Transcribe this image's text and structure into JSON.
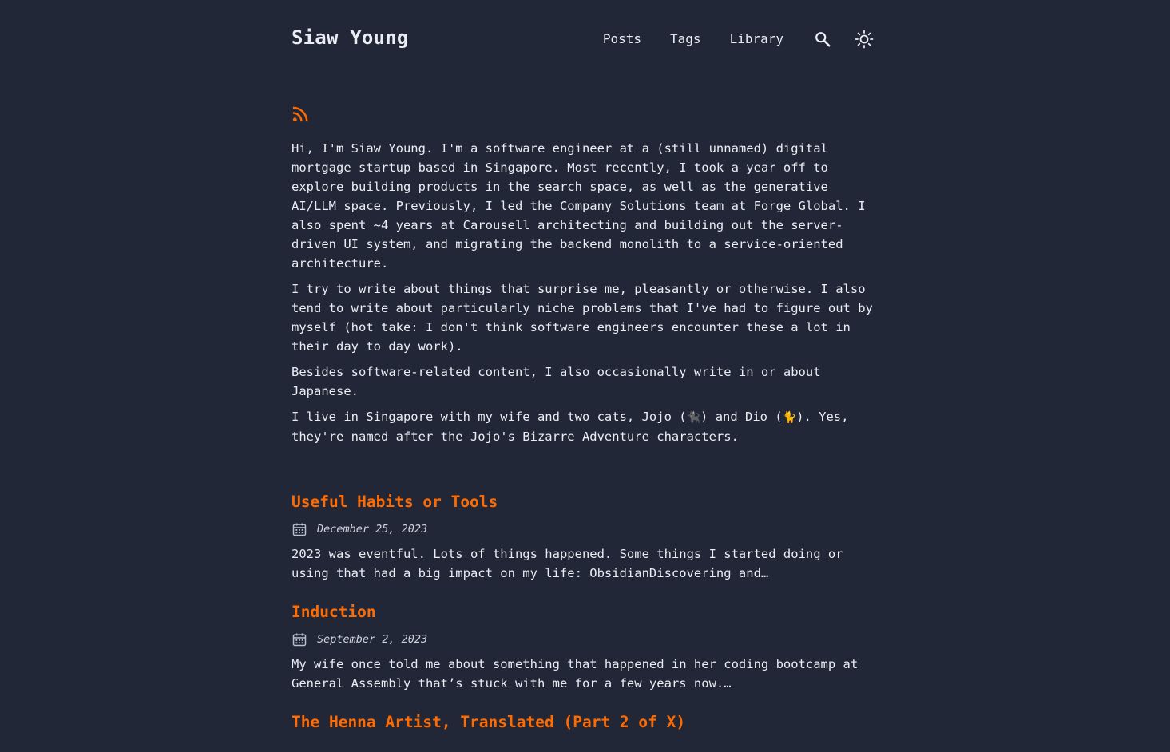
{
  "header": {
    "site_title": "Siaw Young",
    "nav": {
      "posts": "Posts",
      "tags": "Tags",
      "library": "Library"
    },
    "icons": {
      "search": "search-icon",
      "theme": "sun-icon",
      "rss": "rss-icon"
    }
  },
  "intro": {
    "p1": "Hi, I'm Siaw Young. I'm a software engineer at a (still unnamed) digital mortgage startup based in Singapore. Most recently, I took a year off to explore building products in the search space, as well as the generative AI/LLM space. Previously, I led the Company Solutions team at Forge Global. I also spent ~4 years at Carousell architecting and building out the server-driven UI system, and migrating the backend monolith to a service-oriented architecture.",
    "p2": "I try to write about things that surprise me, pleasantly or otherwise. I also tend to write about particularly niche problems that I've had to figure out by myself (hot take: I don't think software engineers encounter these a lot in their day to day work).",
    "p3": "Besides software-related content, I also occasionally write in or about Japanese.",
    "p4_a": "I live in Singapore with my wife and two cats, Jojo (",
    "p4_emoji1": "🐈‍⬛",
    "p4_b": ") and Dio (",
    "p4_emoji2": "🐈",
    "p4_c": "). Yes, they're named after the Jojo's Bizarre Adventure characters."
  },
  "posts": [
    {
      "title": "Useful Habits or Tools",
      "date": "December 25, 2023",
      "excerpt": "2023 was eventful. Lots of things happened. Some things I started doing or using that had a big impact on my life: ObsidianDiscovering and…"
    },
    {
      "title": "Induction",
      "date": "September 2, 2023",
      "excerpt": "My wife once told me about something that happened in her coding bootcamp at General Assembly that’s stuck with me for a few years now.…"
    },
    {
      "title": "The Henna Artist, Translated (Part 2 of X)"
    }
  ],
  "colors": {
    "background": "#212737",
    "text": "#eaedf3",
    "accent": "#ff6b01"
  }
}
